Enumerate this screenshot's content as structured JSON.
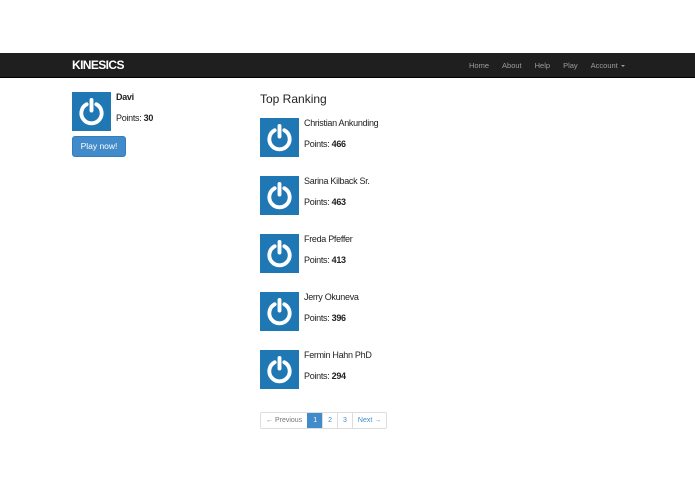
{
  "navbar": {
    "brand": "KINESICS",
    "links": [
      "Home",
      "About",
      "Help",
      "Play"
    ],
    "account_label": "Account"
  },
  "profile": {
    "name": "Davi",
    "points_label": "Points:",
    "points": "30",
    "play_button": "Play now!"
  },
  "ranking": {
    "title": "Top Ranking",
    "points_label": "Points:",
    "items": [
      {
        "name": "Christian Ankunding",
        "points": "466"
      },
      {
        "name": "Sarina Kilback Sr.",
        "points": "463"
      },
      {
        "name": "Freda Pfeffer",
        "points": "413"
      },
      {
        "name": "Jerry Okuneva",
        "points": "396"
      },
      {
        "name": "Fermin Hahn PhD",
        "points": "294"
      }
    ]
  },
  "pagination": {
    "previous": "← Previous",
    "pages": [
      "1",
      "2",
      "3"
    ],
    "active_page": "1",
    "next": "Next →"
  },
  "colors": {
    "navbar_bg": "#1f1f1f",
    "avatar_blue": "#1f78b4",
    "primary": "#428bca"
  },
  "icons": {
    "avatar": "power-icon",
    "account_dropdown": "caret-down-icon"
  }
}
